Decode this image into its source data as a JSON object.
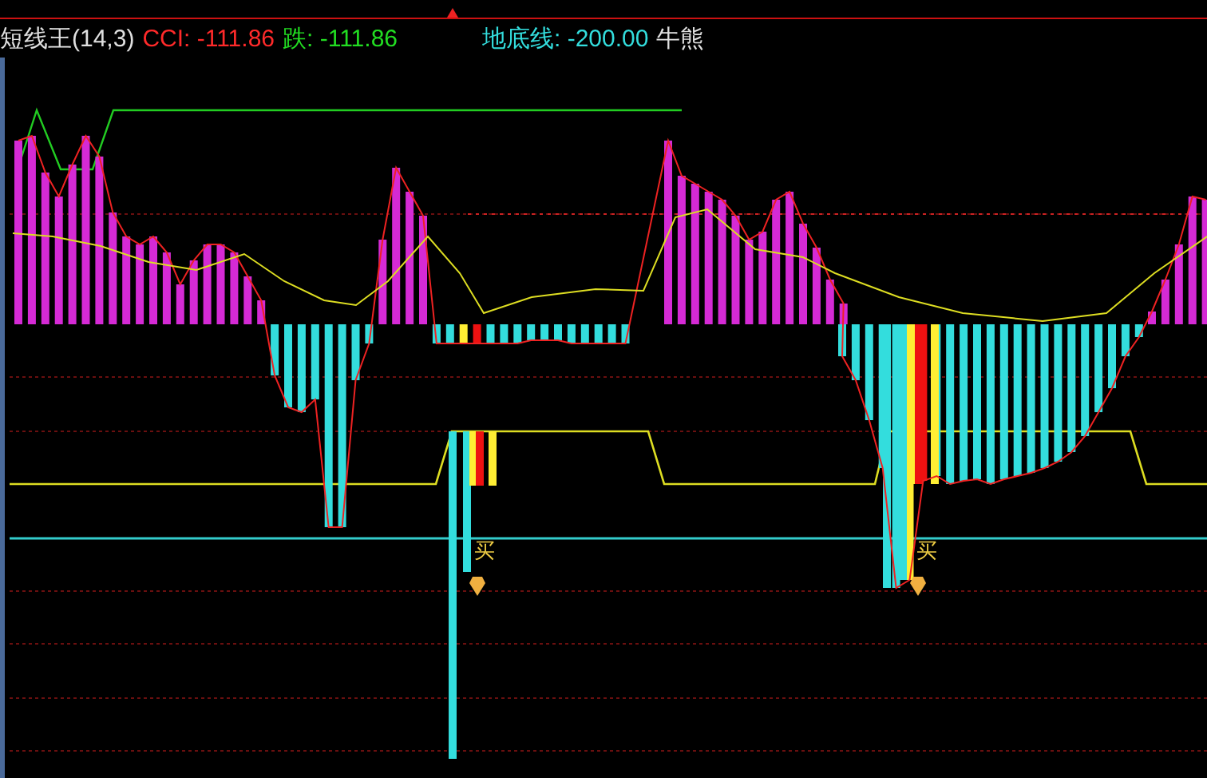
{
  "indicator_legend": [
    {
      "text": "短线王(14,3)",
      "color": "#e0e0e0"
    },
    {
      "text": "CCI: -111.86",
      "color": "#ff2a2a"
    },
    {
      "text": "跌: -111.86",
      "color": "#22dd22"
    }
  ],
  "reference_legend": [
    {
      "text": "地底线: -200.00",
      "color": "#33dddd"
    },
    {
      "text": "牛熊",
      "color": "#e0e0e0"
    }
  ],
  "buy_signals": [
    {
      "label": "买"
    },
    {
      "label": "买"
    }
  ]
}
